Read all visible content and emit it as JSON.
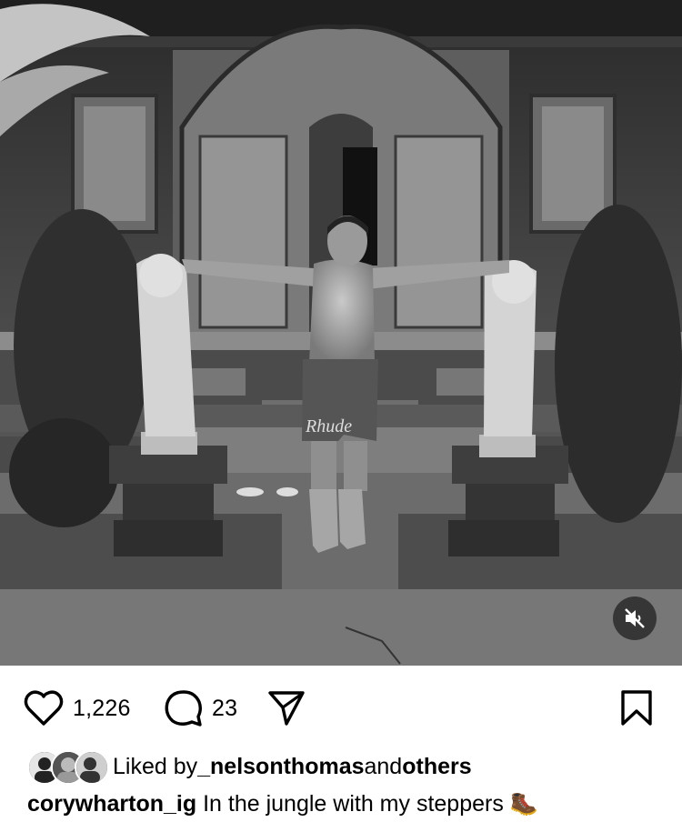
{
  "post": {
    "media_alt": "Black and white photo of a man standing with arms outstretched between two stone statues in front of an ornate carved temple doorway",
    "media_muted": true,
    "icons": {
      "mute": "speaker-muted-icon",
      "like": "heart-icon",
      "comment": "comment-bubble-icon",
      "share": "paper-plane-icon",
      "save": "bookmark-icon"
    },
    "likes_count": "1,226",
    "comments_count": "23",
    "liked_by": {
      "prefix": "Liked by ",
      "user": "_nelsonthomas",
      "middle": " and ",
      "others": "others"
    },
    "caption": {
      "username": "corywharton_ig",
      "text": "In the jungle with my steppers 🥾"
    }
  }
}
